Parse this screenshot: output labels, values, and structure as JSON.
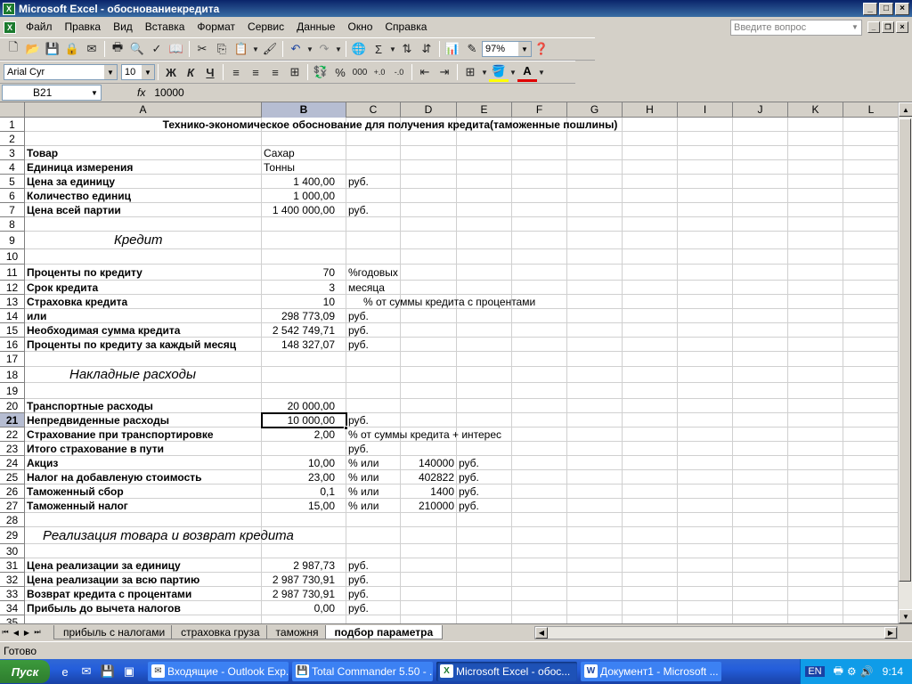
{
  "window": {
    "title": "Microsoft Excel - обоснованиекредита",
    "app_icon": "excel-icon",
    "min": "_",
    "max": "□",
    "close": "×"
  },
  "menu": {
    "items": [
      "Файл",
      "Правка",
      "Вид",
      "Вставка",
      "Формат",
      "Сервис",
      "Данные",
      "Окно",
      "Справка"
    ],
    "help_placeholder": "Введите вопрос"
  },
  "toolbar": {
    "zoom": "97%",
    "font": "Arial Cyr",
    "size": "10",
    "bold": "Ж",
    "italic": "К",
    "underline": "Ч",
    "percent": "%",
    "thousands": "000",
    "sigma": "Σ",
    "font_color_letter": "A"
  },
  "formula_bar": {
    "cell_ref": "B21",
    "fx": "fx",
    "value": "10000"
  },
  "columns": [
    "A",
    "B",
    "C",
    "D",
    "E",
    "F",
    "G",
    "H",
    "I",
    "J",
    "K",
    "L"
  ],
  "rows": [
    "1",
    "2",
    "3",
    "4",
    "5",
    "6",
    "7",
    "8",
    "9",
    "10",
    "11",
    "12",
    "13",
    "14",
    "15",
    "16",
    "17",
    "18",
    "19",
    "20",
    "21",
    "22",
    "23",
    "24",
    "25",
    "26",
    "27",
    "28",
    "29",
    "30",
    "31",
    "32",
    "33",
    "34",
    "35"
  ],
  "cells": {
    "r1": {
      "a": "Технико-экономическое обоснование для получения кредита(таможенные пошлины)"
    },
    "r3": {
      "a": "Товар",
      "b": "Сахар"
    },
    "r4": {
      "a": "Единица измерения",
      "b": "Тонны"
    },
    "r5": {
      "a": "Цена за единицу",
      "b": "1 400,00",
      "c": "руб."
    },
    "r6": {
      "a": "Количество единиц",
      "b": "1 000,00"
    },
    "r7": {
      "a": "Цена всей партии",
      "b": "1 400 000,00",
      "c": "руб."
    },
    "r9": {
      "a": "Кредит"
    },
    "r11": {
      "a": "Проценты по кредиту",
      "b": "70",
      "c": "%годовых"
    },
    "r12": {
      "a": "Срок кредита",
      "b": "3",
      "c": "месяца"
    },
    "r13": {
      "a": "Страховка кредита",
      "b": "10",
      "c": "% от суммы кредита с процентами"
    },
    "r14": {
      "a": "или",
      "b": "298 773,09",
      "c": "руб."
    },
    "r15": {
      "a": "Необходимая сумма кредита",
      "b": "2 542 749,71",
      "c": "руб."
    },
    "r16": {
      "a": "Проценты по кредиту за каждый месяц",
      "b": "148 327,07",
      "c": "руб."
    },
    "r18": {
      "a": "Накладные расходы"
    },
    "r20": {
      "a": "Транспортные расходы",
      "b": "20 000,00"
    },
    "r21": {
      "a": "Непредвиденные расходы",
      "b": "10 000,00",
      "c": "руб."
    },
    "r22": {
      "a": "Страхование при транспортировке",
      "b": "2,00",
      "c": "% от суммы кредита + интерес"
    },
    "r23": {
      "a": "Итого страхование в пути",
      "c": "руб."
    },
    "r24": {
      "a": "Акциз",
      "b": "10,00",
      "c": "% или",
      "d": "140000",
      "e": "руб."
    },
    "r25": {
      "a": "Налог на добавленую стоимость",
      "b": "23,00",
      "c": "% или",
      "d": "402822",
      "e": "руб."
    },
    "r26": {
      "a": "Таможенный сбор",
      "b": "0,1",
      "c": "% или",
      "d": "1400",
      "e": "руб."
    },
    "r27": {
      "a": "Таможенный налог",
      "b": "15,00",
      "c": "% или",
      "d": "210000",
      "e": "руб."
    },
    "r29": {
      "a": "Реализация товара и возврат кредита"
    },
    "r31": {
      "a": "Цена реализации за единицу",
      "b": "2 987,73",
      "c": "руб."
    },
    "r32": {
      "a": "Цена реализации за всю партию",
      "b": "2 987 730,91",
      "c": "руб."
    },
    "r33": {
      "a": "Возврат кредита с процентами",
      "b": "2 987 730,91",
      "c": "руб."
    },
    "r34": {
      "a": "Прибыль до вычета налогов",
      "b": "0,00",
      "c": "руб."
    }
  },
  "sheet_tabs": [
    "прибыль с налогами",
    "страховка груза",
    "таможня",
    "подбор параметра"
  ],
  "status": "Готово",
  "taskbar": {
    "start": "Пуск",
    "tasks": [
      "Входящие - Outlook Exp...",
      "Total Commander 5.50 - ...",
      "Microsoft Excel - обос...",
      "Документ1 - Microsoft ..."
    ],
    "lang": "EN",
    "clock": "9:14"
  }
}
